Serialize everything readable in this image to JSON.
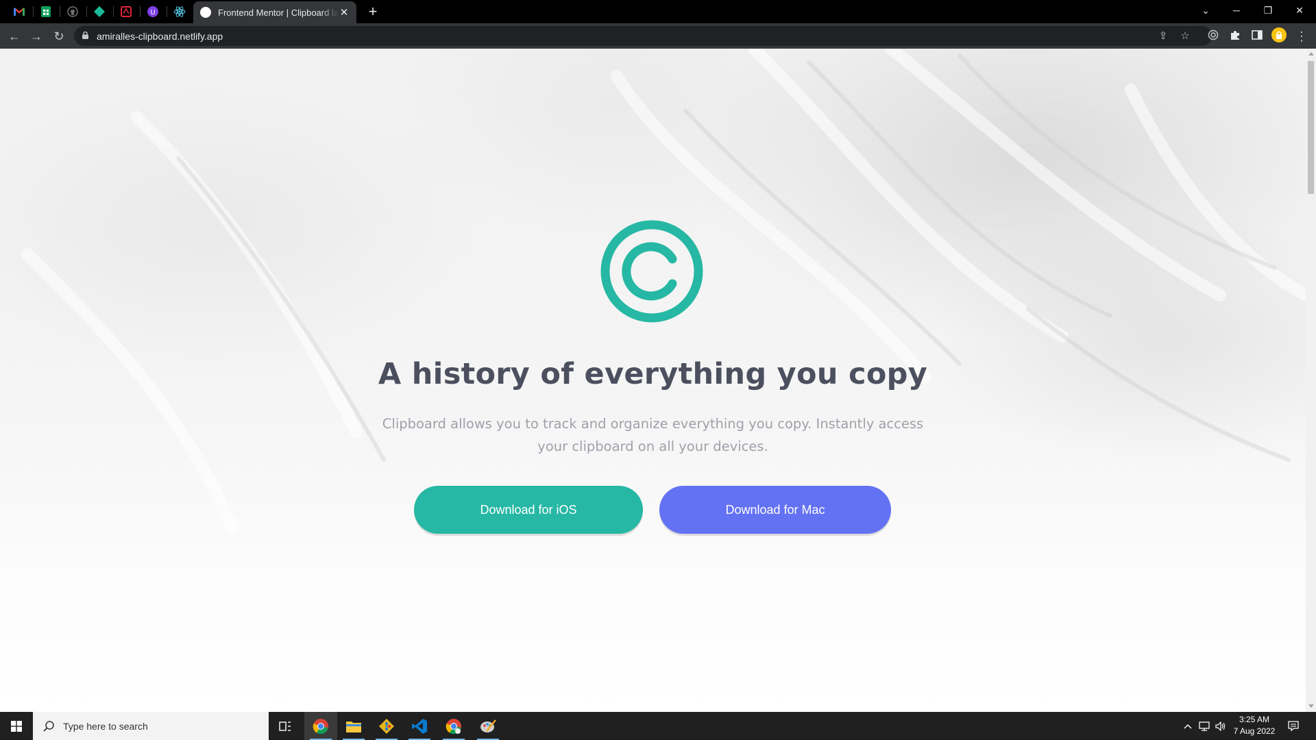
{
  "browser": {
    "pinned_tabs": [
      {
        "name": "gmail",
        "color": "#ea4335"
      },
      {
        "name": "sheets",
        "color": "#0f9d58"
      },
      {
        "name": "github",
        "color": "#6e6e6e"
      },
      {
        "name": "diamond-app",
        "color": "#1abc9c"
      },
      {
        "name": "design-app",
        "color": "#e0243a"
      },
      {
        "name": "notion-like",
        "color": "#7b3fe4"
      },
      {
        "name": "react",
        "color": "#61dafb"
      }
    ],
    "active_tab": {
      "title": "Frontend Mentor | Clipboard landing page",
      "close_glyph": "✕"
    },
    "new_tab_glyph": "+",
    "window_controls": {
      "tab_search": "⌄",
      "minimize": "─",
      "restore": "❐",
      "close": "✕"
    },
    "address": {
      "url": "amiralles-clipboard.netlify.app"
    },
    "nav": {
      "back": "←",
      "forward": "→",
      "reload": "↻"
    },
    "toolbar_icons": {
      "share": "⇪",
      "bookmark": "☆",
      "menu": "⋮"
    }
  },
  "page": {
    "headline": "A history of everything you copy",
    "subtext": "Clipboard allows you to track and organize everything you copy. Instantly access your clipboard on all your devices.",
    "buttons": {
      "ios": "Download for iOS",
      "mac": "Download for Mac"
    },
    "colors": {
      "accent": "#26b8a4",
      "mac_button": "#6371f3",
      "heading": "#4c4f5e",
      "body": "#9ea1aa"
    }
  },
  "taskbar": {
    "search_placeholder": "Type here to search",
    "clock": {
      "time": "3:25 AM",
      "date": "7 Aug 2022"
    },
    "apps": [
      "task-view",
      "chrome",
      "file-explorer",
      "git",
      "vscode",
      "chrome-dev",
      "paint"
    ]
  }
}
